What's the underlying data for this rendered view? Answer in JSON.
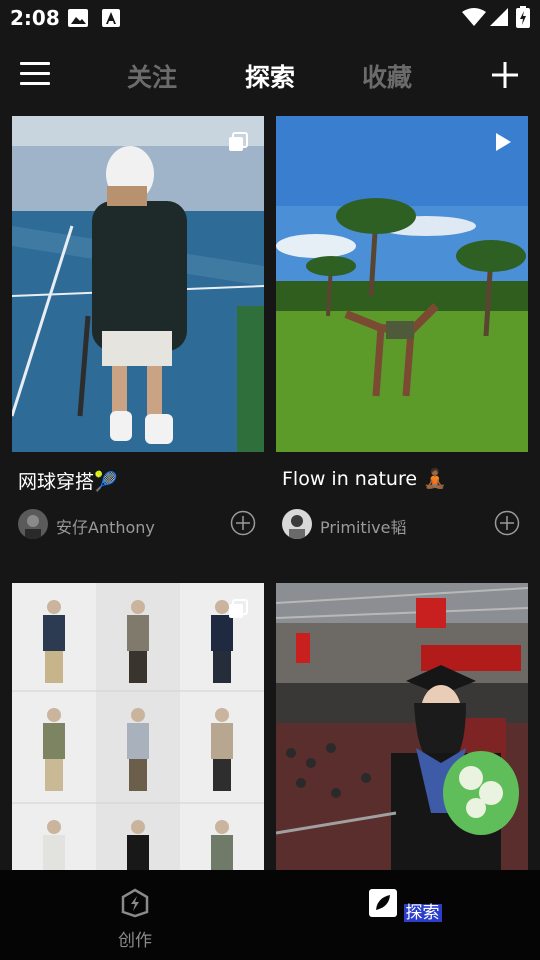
{
  "status_bar": {
    "time": "2:08"
  },
  "nav": {
    "tabs": [
      {
        "label": "关注",
        "active": false
      },
      {
        "label": "探索",
        "active": true
      },
      {
        "label": "收藏",
        "active": false
      }
    ]
  },
  "feed": [
    {
      "title": "网球穿搭🎾",
      "author": "安仔Anthony",
      "media": "multi-image"
    },
    {
      "title": "Flow in nature 🧘🏾",
      "author": "Primitive韬",
      "media": "video"
    },
    {
      "title": "",
      "author": "",
      "media": "multi-image"
    },
    {
      "title": "",
      "author": "",
      "media": "image"
    }
  ],
  "bottom_nav": {
    "items": [
      {
        "label": "创作",
        "active": false
      },
      {
        "label": "探索",
        "active": true
      }
    ]
  },
  "colors": {
    "background": "#161616",
    "active_tab": "#ffffff",
    "inactive_tab": "#6b6b6b",
    "bottom_active_highlight": "#2b3ec9"
  }
}
